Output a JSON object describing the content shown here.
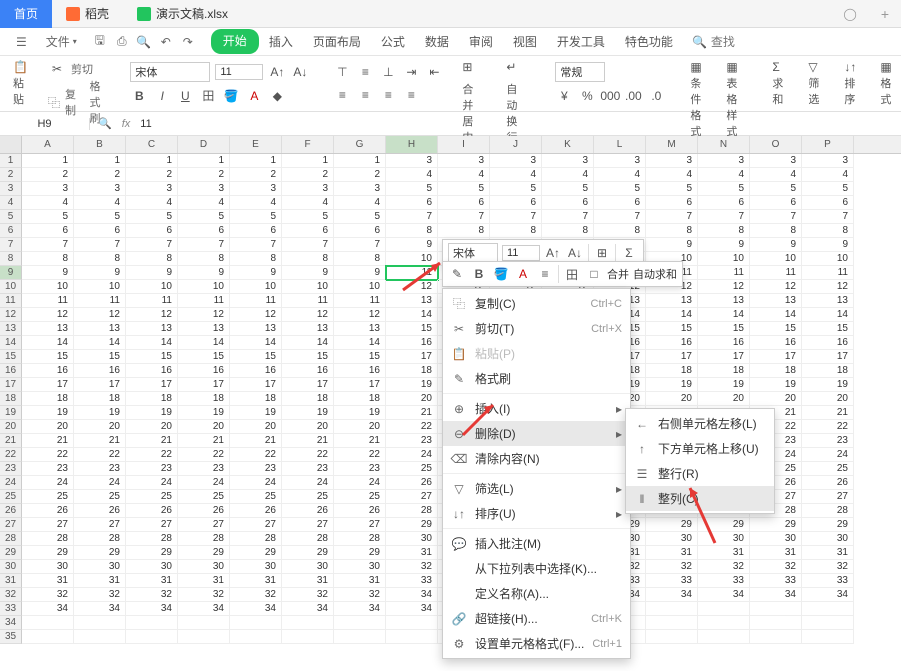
{
  "tabs": {
    "home": "首页",
    "doc1": "稻壳",
    "doc2": "演示文稿.xlsx"
  },
  "menu": {
    "file": "文件",
    "tabs": [
      "开始",
      "插入",
      "页面布局",
      "公式",
      "数据",
      "审阅",
      "视图",
      "开发工具",
      "特色功能"
    ],
    "search_placeholder": "查找"
  },
  "ribbon": {
    "paste": "粘贴",
    "cut": "剪切",
    "copy": "复制",
    "format_painter": "格式刷",
    "font_name": "宋体",
    "font_size": "11",
    "merge_center": "合并居中",
    "wrap_text": "自动换行",
    "general": "常规",
    "cond_format": "条件格式",
    "table_style": "表格样式",
    "sum": "求和",
    "filter": "筛选",
    "sort": "排序",
    "format": "格式"
  },
  "formula_bar": {
    "cell": "H9",
    "value": "11"
  },
  "columns": [
    "A",
    "B",
    "C",
    "D",
    "E",
    "F",
    "G",
    "H",
    "I",
    "J",
    "K",
    "L",
    "M",
    "N",
    "O",
    "P"
  ],
  "row_count": 35,
  "mini_toolbar": {
    "font_name": "宋体",
    "font_size": "11",
    "merge": "合并",
    "autosum": "自动求和"
  },
  "context_menu": {
    "copy": "复制(C)",
    "copy_sc": "Ctrl+C",
    "cut": "剪切(T)",
    "cut_sc": "Ctrl+X",
    "paste": "粘贴(P)",
    "format_painter": "格式刷",
    "insert": "插入(I)",
    "delete": "删除(D)",
    "clear": "清除内容(N)",
    "filter": "筛选(L)",
    "sort": "排序(U)",
    "comment": "插入批注(M)",
    "select_from_list": "从下拉列表中选择(K)...",
    "define_name": "定义名称(A)...",
    "hyperlink": "超链接(H)...",
    "hyperlink_sc": "Ctrl+K",
    "format_cells": "设置单元格格式(F)...",
    "format_cells_sc": "Ctrl+1"
  },
  "submenu": {
    "shift_left": "右侧单元格左移(L)",
    "shift_up": "下方单元格上移(U)",
    "entire_row": "整行(R)",
    "entire_col": "整列(C)"
  }
}
